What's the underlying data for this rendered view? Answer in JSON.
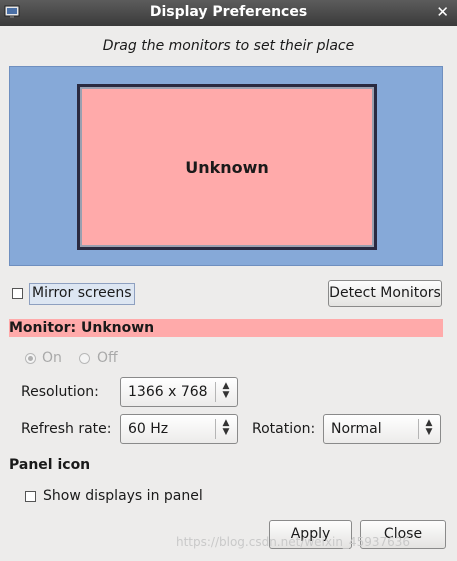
{
  "window": {
    "title": "Display Preferences"
  },
  "instruction": "Drag the monitors to set their place",
  "canvas": {
    "background": "#86a9d8",
    "monitor": {
      "label": "Unknown",
      "color": "#ffaaaa"
    }
  },
  "mirror_screens": {
    "label": "Mirror screens",
    "checked": false
  },
  "detect_button": {
    "label": "Detect Monitors"
  },
  "monitor_header": {
    "label": "Monitor: Unknown",
    "color": "#ffaaaa"
  },
  "power": {
    "on_label": "On",
    "off_label": "Off",
    "selected": "On",
    "enabled": false
  },
  "resolution": {
    "label": "Resolution:",
    "value": "1366 x 768"
  },
  "refresh_rate": {
    "label": "Refresh rate:",
    "value": "60 Hz"
  },
  "rotation": {
    "label": "Rotation:",
    "value": "Normal"
  },
  "panel_icon": {
    "heading": "Panel icon",
    "show_label": "Show displays in panel",
    "checked": false
  },
  "buttons": {
    "apply": "Apply",
    "close": "Close"
  },
  "watermark": "https://blog.csdn.net/weixin_45937636"
}
